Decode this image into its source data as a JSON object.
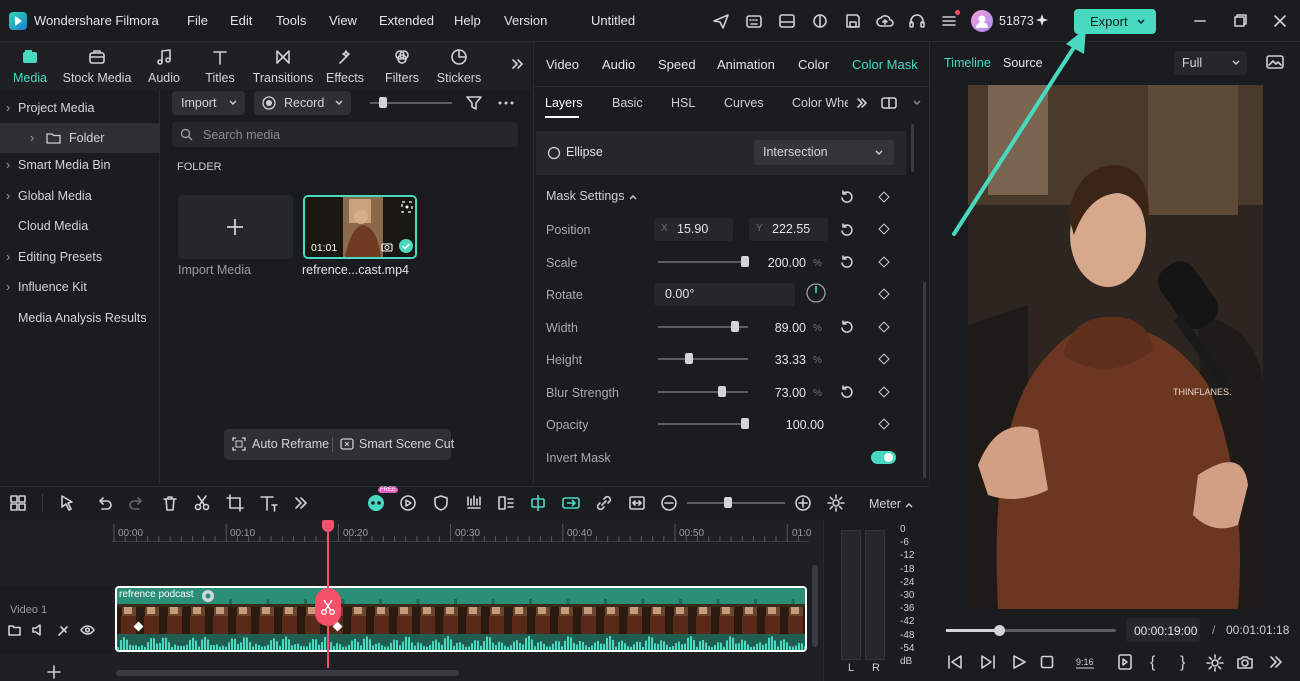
{
  "app": {
    "name": "Wondershare Filmora",
    "project_title": "Untitled",
    "credits": "51873",
    "export_label": "Export"
  },
  "menu": [
    "File",
    "Edit",
    "Tools",
    "View",
    "Extended",
    "Help",
    "Version"
  ],
  "media_tabs": [
    {
      "label": "Media",
      "icon": "media-icon",
      "active": true
    },
    {
      "label": "Stock Media",
      "icon": "stock-media-icon"
    },
    {
      "label": "Audio",
      "icon": "audio-icon"
    },
    {
      "label": "Titles",
      "icon": "titles-icon"
    },
    {
      "label": "Transitions",
      "icon": "transitions-icon"
    },
    {
      "label": "Effects",
      "icon": "effects-icon"
    },
    {
      "label": "Filters",
      "icon": "filters-icon"
    },
    {
      "label": "Stickers",
      "icon": "stickers-icon"
    }
  ],
  "sidebar": {
    "items": [
      "Project Media",
      "Folder",
      "Smart Media Bin",
      "Global Media",
      "Cloud Media",
      "Editing Presets",
      "Influence Kit",
      "Media Analysis Results"
    ]
  },
  "media_toolbar": {
    "import_label": "Import",
    "record_label": "Record",
    "search_placeholder": "Search media",
    "folder_heading": "FOLDER"
  },
  "media_items": [
    {
      "label": "Import Media"
    },
    {
      "label": "refrence...cast.mp4",
      "duration": "01:01"
    }
  ],
  "media_actions": {
    "auto_reframe": "Auto Reframe",
    "smart_scene_cut": "Smart Scene Cut"
  },
  "property_tabs": [
    "Video",
    "Audio",
    "Speed",
    "Animation",
    "Color",
    "Color Mask"
  ],
  "active_property_tab": "Color Mask",
  "sub_tabs": [
    "Layers",
    "Basic",
    "HSL",
    "Curves",
    "Color Whe"
  ],
  "mask": {
    "shape": "Ellipse",
    "mode": "Intersection",
    "settings_title": "Mask Settings"
  },
  "settings": {
    "position": {
      "label": "Position",
      "x_label": "X",
      "x": "15.90",
      "y_label": "Y",
      "y": "222.55"
    },
    "scale": {
      "label": "Scale",
      "value": "200.00",
      "unit": "%",
      "level": 0.97
    },
    "rotate": {
      "label": "Rotate",
      "value": "0.00°"
    },
    "width": {
      "label": "Width",
      "value": "89.00",
      "unit": "%",
      "level": 0.85
    },
    "height": {
      "label": "Height",
      "value": "33.33",
      "unit": "%",
      "level": 0.34
    },
    "blur": {
      "label": "Blur Strength",
      "value": "73.00",
      "unit": "%",
      "level": 0.71
    },
    "opacity": {
      "label": "Opacity",
      "value": "100.00",
      "level": 0.97
    },
    "invert": {
      "label": "Invert Mask",
      "on": true
    }
  },
  "preview": {
    "tab_timeline": "Timeline",
    "tab_source": "Source",
    "quality": "Full",
    "current_time": "00:00:19:00",
    "total_time": "00:01:01:18",
    "separator": "/",
    "progress": 0.31,
    "hoodie_text": "THINFLANES."
  },
  "timeline": {
    "ticks": [
      "00:00",
      "00:10",
      "00:20",
      "00:30",
      "00:40",
      "00:50",
      "01:0"
    ],
    "track_label": "Video 1",
    "clip_label": "refrence podcast",
    "meter_label": "Meter",
    "meter_scale": [
      "0",
      "-6",
      "-12",
      "-18",
      "-24",
      "-30",
      "-36",
      "-42",
      "-48",
      "-54",
      "dB"
    ],
    "meter_channels": [
      "L",
      "R"
    ],
    "free_badge": "FREE"
  },
  "colors": {
    "accent": "#49d9c1",
    "playhead": "#f4506a",
    "clip": "#2b8f77"
  }
}
